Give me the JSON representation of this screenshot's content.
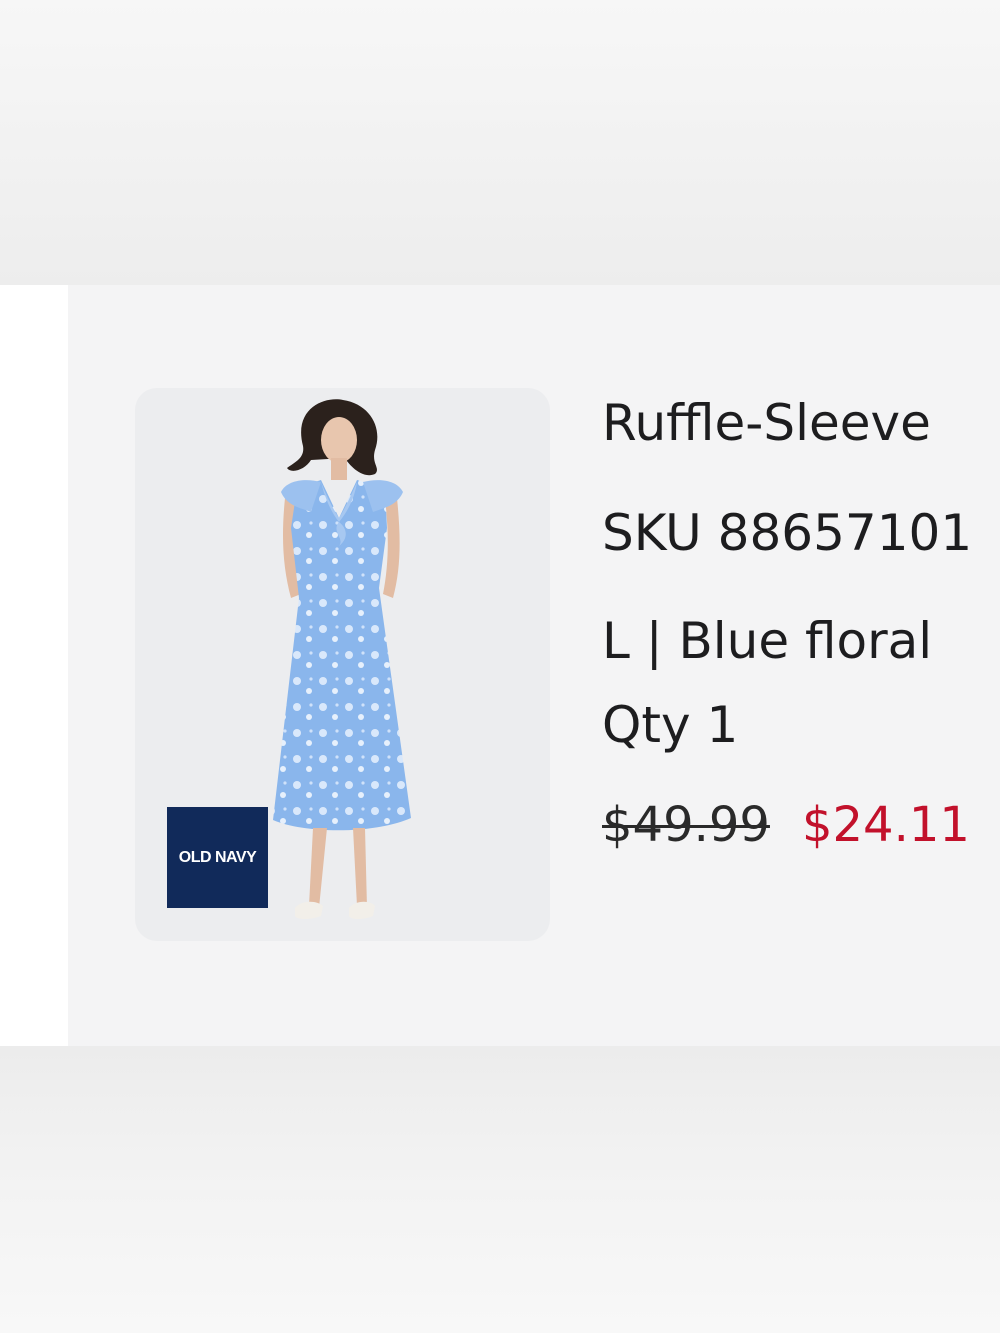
{
  "product": {
    "title": "Ruffle-Sleeve",
    "sku": "SKU 88657101",
    "variant": "L | Blue floral",
    "quantity": "Qty 1",
    "original_price": "$49.99",
    "sale_price": "$24.11",
    "brand_badge": "OLD NAVY"
  },
  "colors": {
    "sale_price": "#c2112b",
    "brand_badge_bg": "#112a5a",
    "dress": "#8ab6ec"
  }
}
